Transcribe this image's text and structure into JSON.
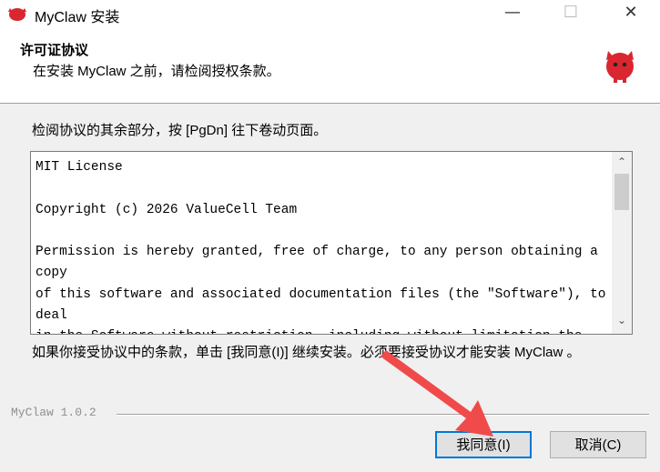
{
  "window": {
    "title": "MyClaw 安装",
    "min_glyph": "—",
    "max_glyph": "☐",
    "close_glyph": "✕"
  },
  "header": {
    "title": "许可证协议",
    "subtitle": "在安装 MyClaw 之前，请检阅授权条款。"
  },
  "instructions": "检阅协议的其余部分，按 [PgDn] 往下卷动页面。",
  "license": {
    "text": "MIT License\n\nCopyright (c) 2026 ValueCell Team\n\nPermission is hereby granted, free of charge, to any person obtaining a copy\nof this software and associated documentation files (the \"Software\"), to deal\nin the Software without restriction, including without limitation the"
  },
  "accept_text": "如果你接受协议中的条款，单击 [我同意(I)] 继续安装。必须要接受协议才能安装 MyClaw 。",
  "version": "MyClaw 1.0.2",
  "buttons": {
    "agree": "我同意(I)",
    "cancel": "取消(C)"
  },
  "scrollbar": {
    "up_glyph": "⌃",
    "down_glyph": "⌄"
  },
  "colors": {
    "accent": "#0078d7",
    "arrow": "#f04a4a",
    "logo": "#d9262f"
  },
  "icons": {
    "app": "red-mascot-icon",
    "header": "red-mascot-icon"
  }
}
